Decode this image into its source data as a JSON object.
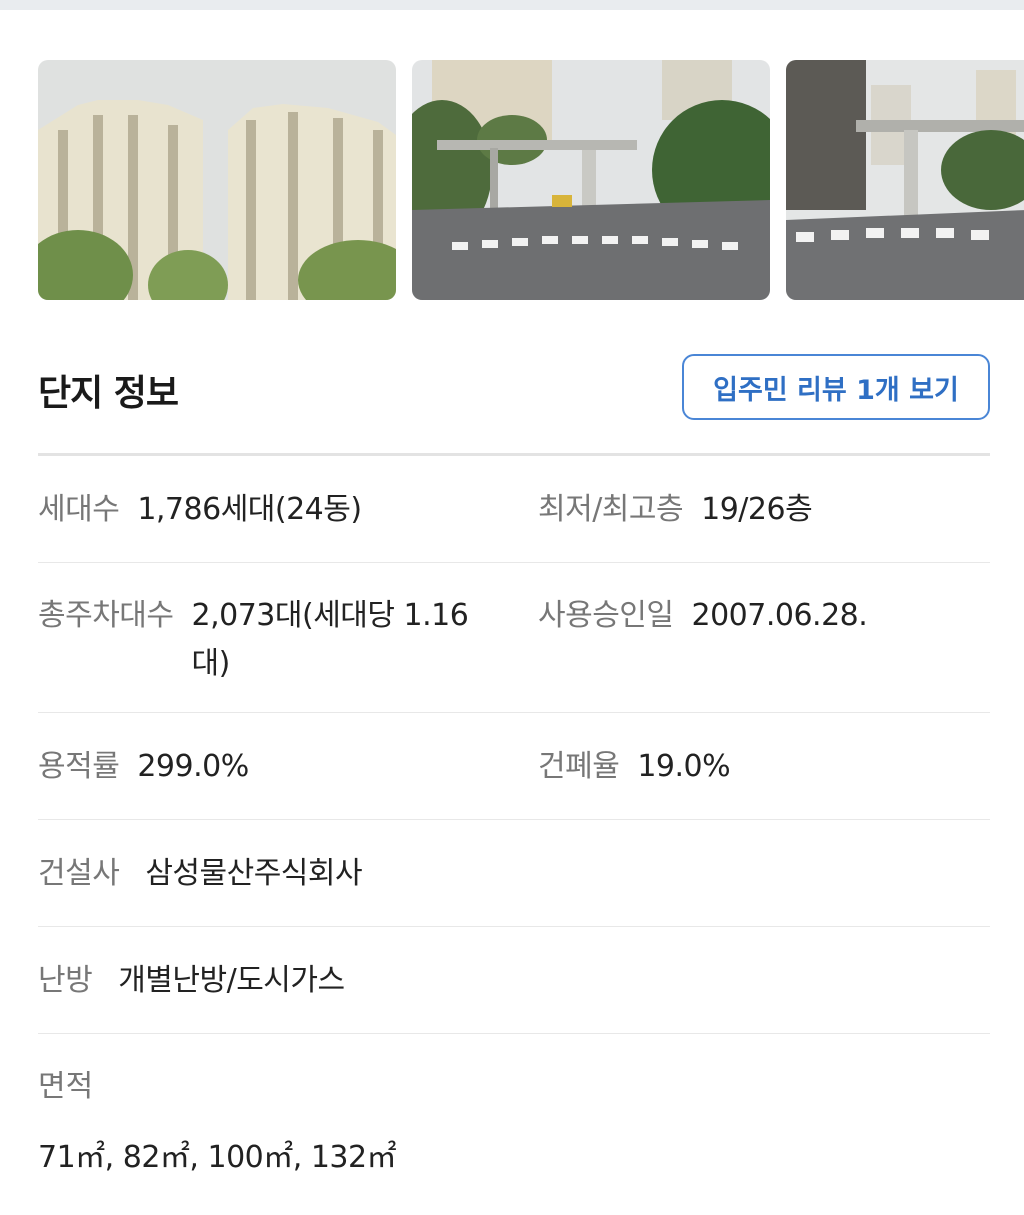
{
  "photos": [
    {
      "alt": "apartment-towers-photo"
    },
    {
      "alt": "complex-entrance-gate-photo"
    },
    {
      "alt": "street-entrance-photo"
    }
  ],
  "section": {
    "title": "단지 정보",
    "review_button_label": "입주민 리뷰 1개 보기"
  },
  "info": {
    "households": {
      "label": "세대수",
      "value": "1,786세대(24동)"
    },
    "floors": {
      "label": "최저/최고층",
      "value": "19/26층"
    },
    "parking": {
      "label": "총주차대수",
      "value_line1": "2,073대(세대당 1.16",
      "value_line2": "대)"
    },
    "approval_date": {
      "label": "사용승인일",
      "value": "2007.06.28."
    },
    "floor_area_ratio": {
      "label": "용적률",
      "value": "299.0%"
    },
    "building_coverage": {
      "label": "건폐율",
      "value": "19.0%"
    },
    "builder": {
      "label": "건설사",
      "value": "삼성물산주식회사"
    },
    "heating": {
      "label": "난방",
      "value": "개별난방/도시가스"
    },
    "area": {
      "label": "면적",
      "value": "71㎡, 82㎡, 100㎡, 132㎡"
    }
  },
  "colors": {
    "accent": "#2f6fc4",
    "label_gray": "#777777",
    "divider": "#e8e8e8"
  }
}
